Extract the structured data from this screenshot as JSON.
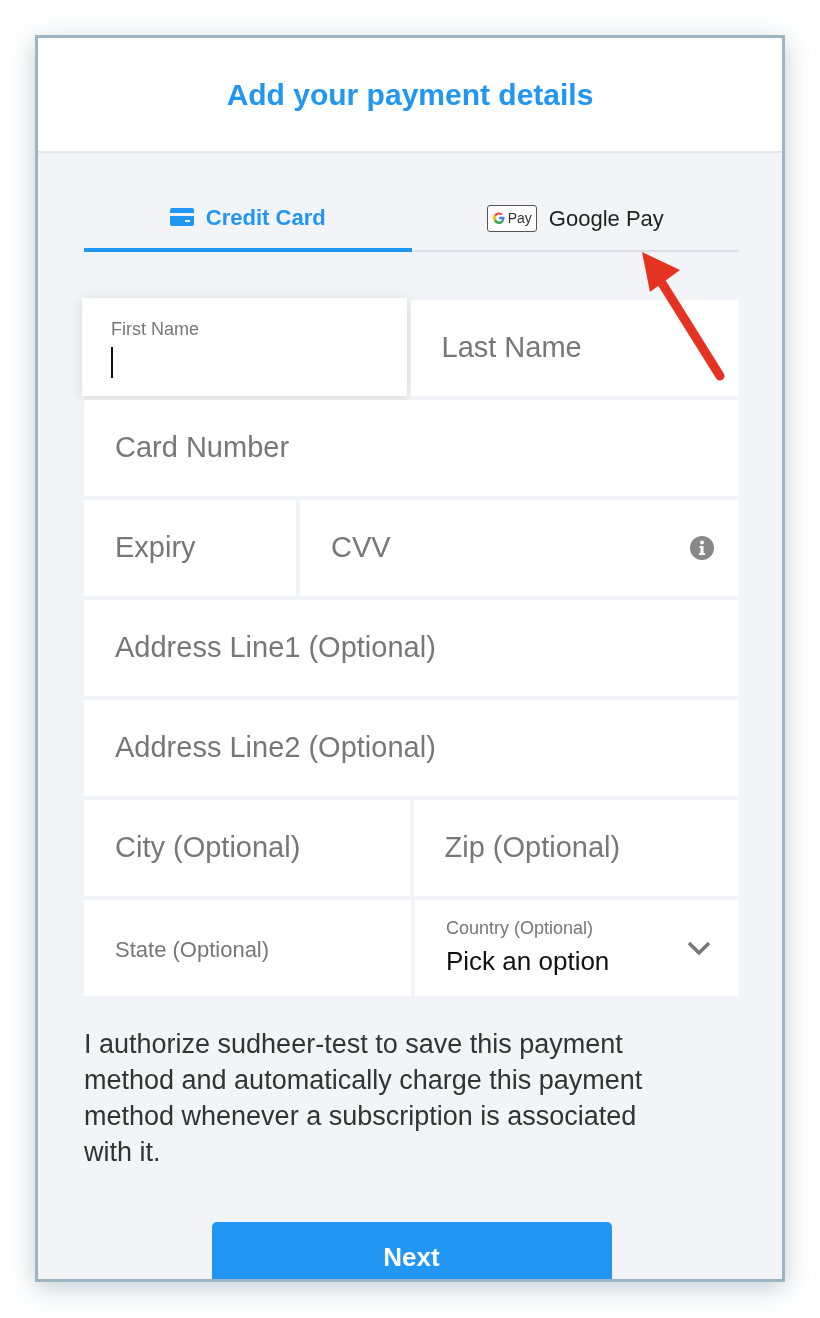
{
  "title": "Add your payment details",
  "tabs": [
    {
      "label": "Credit Card",
      "selected": true,
      "kind": "card"
    },
    {
      "label": "Google Pay",
      "selected": false,
      "kind": "gpay",
      "logo_text": "Pay"
    }
  ],
  "fields": [
    [
      {
        "kind": "text",
        "label": "First Name",
        "focused": true
      },
      {
        "kind": "text",
        "placeholder": "Last Name",
        "focused": false
      }
    ],
    [
      {
        "kind": "text",
        "placeholder": "Card Number",
        "focused": false
      }
    ],
    [
      {
        "kind": "text",
        "placeholder": "Expiry",
        "focused": false
      },
      {
        "kind": "text",
        "placeholder": "CVV",
        "focused": false,
        "info": true
      }
    ],
    [
      {
        "kind": "text",
        "placeholder": "Address Line1 (Optional)",
        "focused": false
      }
    ],
    [
      {
        "kind": "text",
        "placeholder": "Address Line2 (Optional)",
        "focused": false
      }
    ],
    [
      {
        "kind": "text",
        "placeholder": "City (Optional)",
        "focused": false
      },
      {
        "kind": "text",
        "placeholder": "Zip (Optional)",
        "focused": false
      }
    ],
    [
      {
        "kind": "small",
        "placeholder": "State (Optional)",
        "focused": false
      },
      {
        "kind": "select",
        "label": "Country (Optional)",
        "value": "Pick an option"
      }
    ]
  ],
  "consent": "I authorize sudheer-test to save this payment method and automatically charge this payment method whenever a subscription is associated with it.",
  "button": "Next"
}
